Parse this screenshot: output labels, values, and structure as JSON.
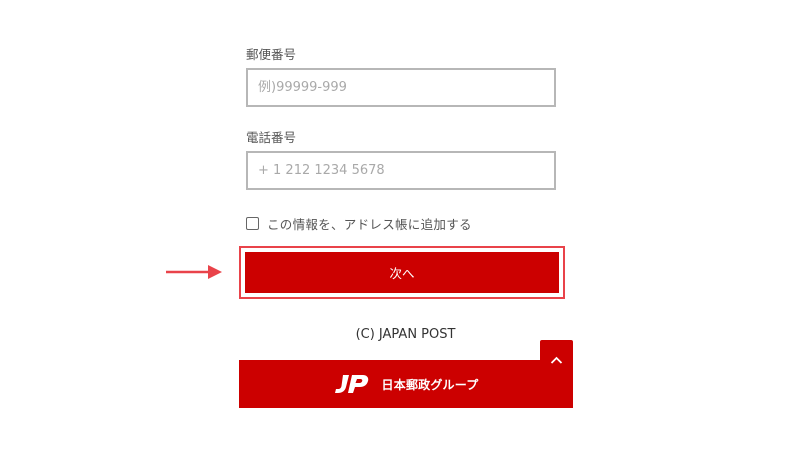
{
  "form": {
    "postal_code_label": "郵便番号",
    "postal_code_placeholder": "例)99999-999",
    "postal_code_value": "",
    "phone_label": "電話番号",
    "phone_placeholder": "+ 1 212 1234 5678",
    "phone_value": "",
    "save_to_address_book_label": "この情報を、アドレス帳に追加する",
    "save_to_address_book_checked": false,
    "next_button_label": "次へ"
  },
  "footer": {
    "copyright": "(C) JAPAN POST",
    "brand_name": "日本郵政グループ",
    "back_to_top_icon": "chevron-up-icon",
    "logo_icon": "jp-logo-icon"
  },
  "annotation": {
    "arrow_icon": "right-arrow-icon"
  },
  "colors": {
    "brand_red": "#cc0000",
    "highlight_red": "#e9434a",
    "input_border": "#b7b7b7"
  }
}
